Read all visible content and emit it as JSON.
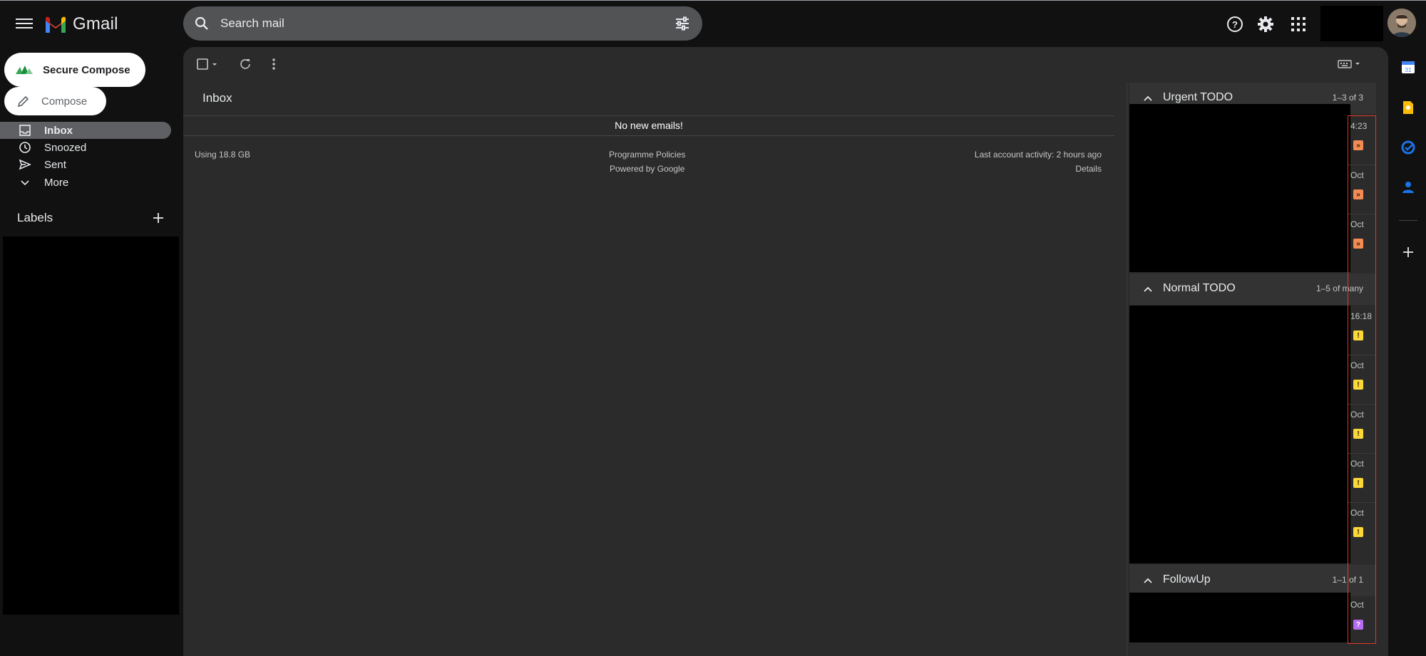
{
  "header": {
    "app_name": "Gmail",
    "search_placeholder": "Search mail"
  },
  "sidebar": {
    "secure_compose_label": "Secure Compose",
    "compose_label": "Compose",
    "items": [
      {
        "label": "Inbox",
        "icon": "inbox-icon"
      },
      {
        "label": "Snoozed",
        "icon": "clock-icon"
      },
      {
        "label": "Sent",
        "icon": "send-icon"
      },
      {
        "label": "More",
        "icon": "chevron-down-icon"
      }
    ],
    "labels_title": "Labels"
  },
  "main": {
    "title": "Inbox",
    "empty_message": "No new emails!",
    "storage": "Using 18.8 GB",
    "policies_link": "Programme Policies",
    "powered_by": "Powered by Google",
    "last_activity": "Last account activity: 2 hours ago",
    "details_link": "Details"
  },
  "right_pane": {
    "sections": [
      {
        "title": "Urgent TODO",
        "count": "1–3 of 3",
        "rows": [
          {
            "time": "4:23",
            "badge": "»"
          },
          {
            "time": "Oct",
            "badge": "»"
          },
          {
            "time": "Oct",
            "badge": "»"
          }
        ]
      },
      {
        "title": "Normal TODO",
        "count": "1–5 of many",
        "rows": [
          {
            "time": "16:18",
            "badge": "!"
          },
          {
            "time": "Oct",
            "badge": "!"
          },
          {
            "time": "Oct",
            "badge": "!"
          },
          {
            "time": "Oct",
            "badge": "!"
          },
          {
            "time": "Oct",
            "badge": "!"
          }
        ]
      },
      {
        "title": "FollowUp",
        "count": "1–1 of 1",
        "rows": [
          {
            "time": "Oct",
            "badge": "?"
          }
        ]
      }
    ]
  },
  "colors": {
    "accent_urgent": "#f28b54",
    "accent_normal": "#fbd737",
    "accent_followup": "#b56cf0",
    "highlight_outline": "#e0382a"
  }
}
